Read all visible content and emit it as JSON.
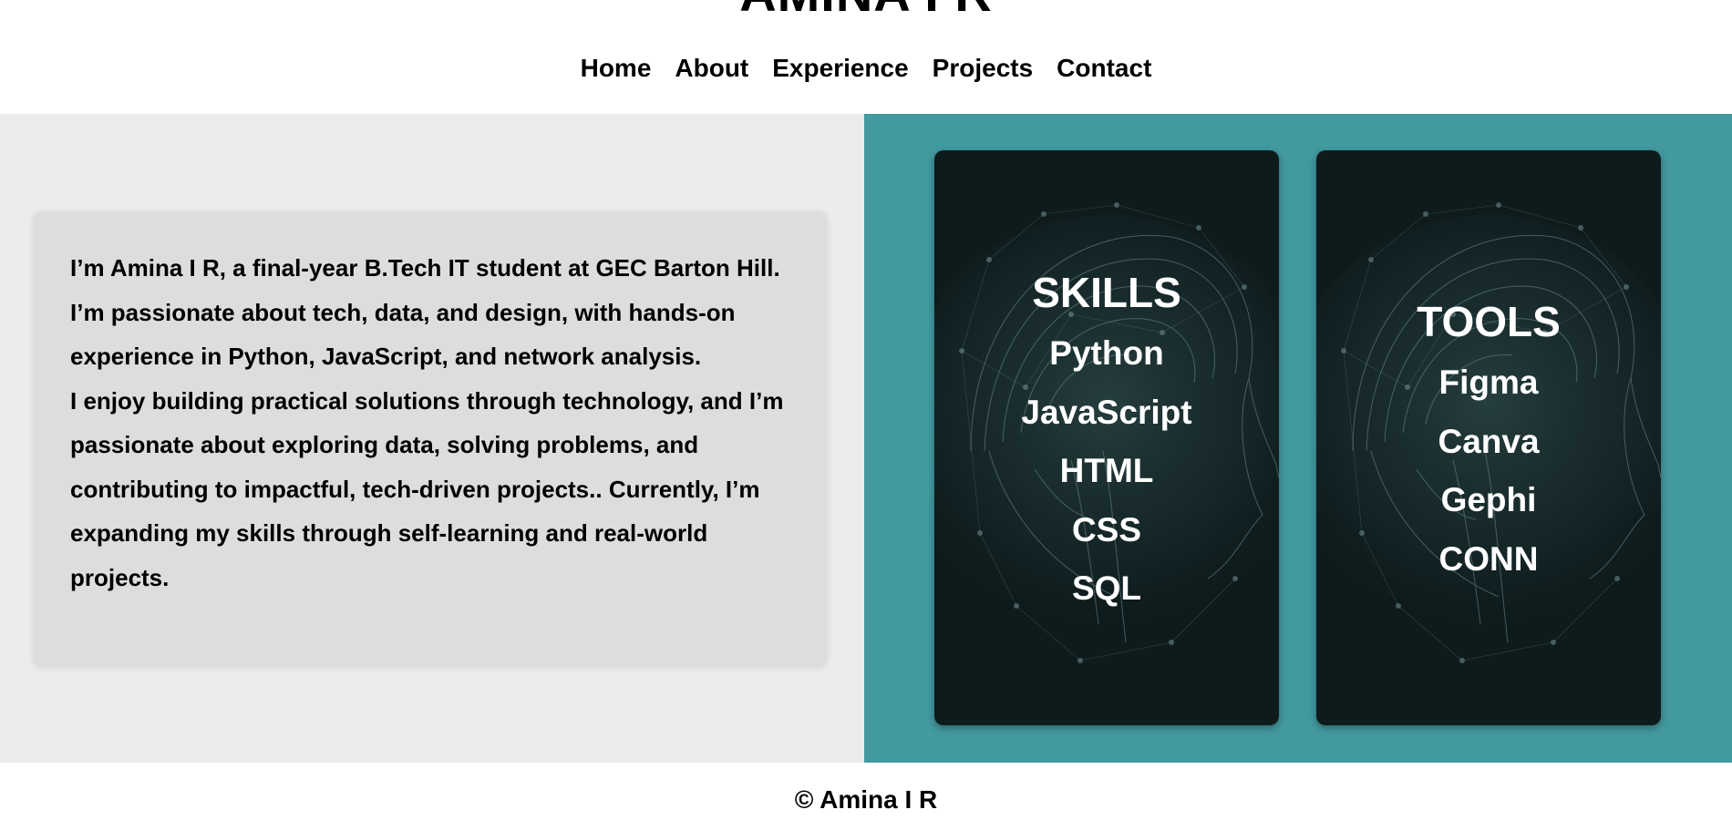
{
  "header": {
    "title": "AMINA I R",
    "nav": [
      "Home",
      "About",
      "Experience",
      "Projects",
      "Contact"
    ]
  },
  "about": {
    "paragraph1": "I’m Amina I R, a final-year B.Tech IT student at GEC Barton Hill. I’m passionate about tech, data, and design, with hands-on experience in Python, JavaScript, and network analysis.",
    "paragraph2": "I enjoy building practical solutions through technology, and I’m passionate about exploring data, solving problems, and contributing to impactful, tech-driven projects.. Currently, I’m expanding my skills through self-learning and real-world projects."
  },
  "skills": {
    "title": "SKILLS",
    "items": [
      "Python",
      "JavaScript",
      "HTML",
      "CSS",
      "SQL"
    ]
  },
  "tools": {
    "title": "TOOLS",
    "items": [
      "Figma",
      "Canva",
      "Gephi",
      "CONN"
    ]
  },
  "footer": {
    "copyright": "© Amina I R"
  },
  "colors": {
    "teal_panel": "#42999f",
    "card_bg": "#0e1b1d",
    "light_panel": "#ececec",
    "about_card": "#dddddd"
  },
  "card_image": "brain-network-illustration"
}
